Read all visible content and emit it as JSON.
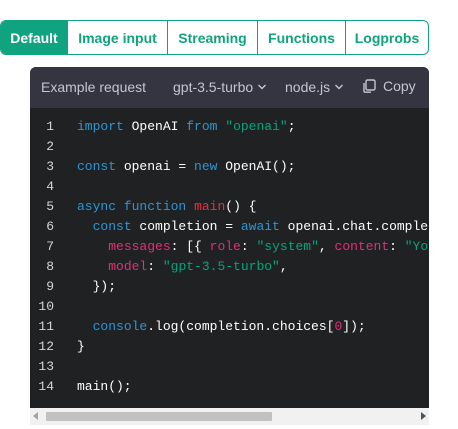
{
  "tabs": [
    {
      "label": "Default",
      "active": true
    },
    {
      "label": "Image input",
      "active": false
    },
    {
      "label": "Streaming",
      "active": false
    },
    {
      "label": "Functions",
      "active": false
    },
    {
      "label": "Logprobs",
      "active": false
    }
  ],
  "panel": {
    "title": "Example request",
    "model": "gpt-3.5-turbo",
    "language": "node.js",
    "copy_label": "Copy"
  },
  "code": {
    "lines": [
      {
        "n": "1",
        "tokens": [
          [
            "kw",
            "import"
          ],
          [
            "pl",
            " OpenAI "
          ],
          [
            "kw",
            "from"
          ],
          [
            "pl",
            " "
          ],
          [
            "str",
            "\"openai\""
          ],
          [
            "pl",
            ";"
          ]
        ]
      },
      {
        "n": "2",
        "tokens": []
      },
      {
        "n": "3",
        "tokens": [
          [
            "kw",
            "const"
          ],
          [
            "pl",
            " openai = "
          ],
          [
            "kw",
            "new"
          ],
          [
            "pl",
            " OpenAI();"
          ]
        ]
      },
      {
        "n": "4",
        "tokens": []
      },
      {
        "n": "5",
        "tokens": [
          [
            "kw",
            "async"
          ],
          [
            "pl",
            " "
          ],
          [
            "kw",
            "function"
          ],
          [
            "pl",
            " "
          ],
          [
            "fn",
            "main"
          ],
          [
            "pl",
            "() {"
          ]
        ]
      },
      {
        "n": "6",
        "tokens": [
          [
            "pl",
            "  "
          ],
          [
            "kw",
            "const"
          ],
          [
            "pl",
            " completion = "
          ],
          [
            "kw",
            "await"
          ],
          [
            "pl",
            " openai.chat.completions.create({"
          ]
        ]
      },
      {
        "n": "7",
        "tokens": [
          [
            "pl",
            "    "
          ],
          [
            "prop",
            "messages"
          ],
          [
            "pl",
            ": [{ "
          ],
          [
            "prop",
            "role"
          ],
          [
            "pl",
            ": "
          ],
          [
            "str",
            "\"system\""
          ],
          [
            "pl",
            ", "
          ],
          [
            "prop",
            "content"
          ],
          [
            "pl",
            ": "
          ],
          [
            "str",
            "\"You are a helpful assistant.\""
          ],
          [
            "pl",
            " }],"
          ]
        ]
      },
      {
        "n": "8",
        "tokens": [
          [
            "pl",
            "    "
          ],
          [
            "prop",
            "model"
          ],
          [
            "pl",
            ": "
          ],
          [
            "str",
            "\"gpt-3.5-turbo\""
          ],
          [
            "pl",
            ","
          ]
        ]
      },
      {
        "n": "9",
        "tokens": [
          [
            "pl",
            "  });"
          ]
        ]
      },
      {
        "n": "10",
        "tokens": []
      },
      {
        "n": "11",
        "tokens": [
          [
            "pl",
            "  "
          ],
          [
            "kw",
            "console"
          ],
          [
            "pl",
            ".log(completion.choices["
          ],
          [
            "num",
            "0"
          ],
          [
            "pl",
            "]);"
          ]
        ]
      },
      {
        "n": "12",
        "tokens": [
          [
            "pl",
            "}"
          ]
        ]
      },
      {
        "n": "13",
        "tokens": []
      },
      {
        "n": "14",
        "tokens": [
          [
            "pl",
            "main();"
          ]
        ]
      }
    ]
  },
  "colors": {
    "accent": "#10a37f",
    "code_bg": "#202123",
    "header_bg": "#343541",
    "keyword": "#2e95d3",
    "string": "#00a67d",
    "property": "#df3079",
    "function": "#f22c3d"
  },
  "icons": {
    "model_dropdown": "chevron-down-icon",
    "language_dropdown": "chevron-down-icon",
    "copy": "copy-icon"
  }
}
